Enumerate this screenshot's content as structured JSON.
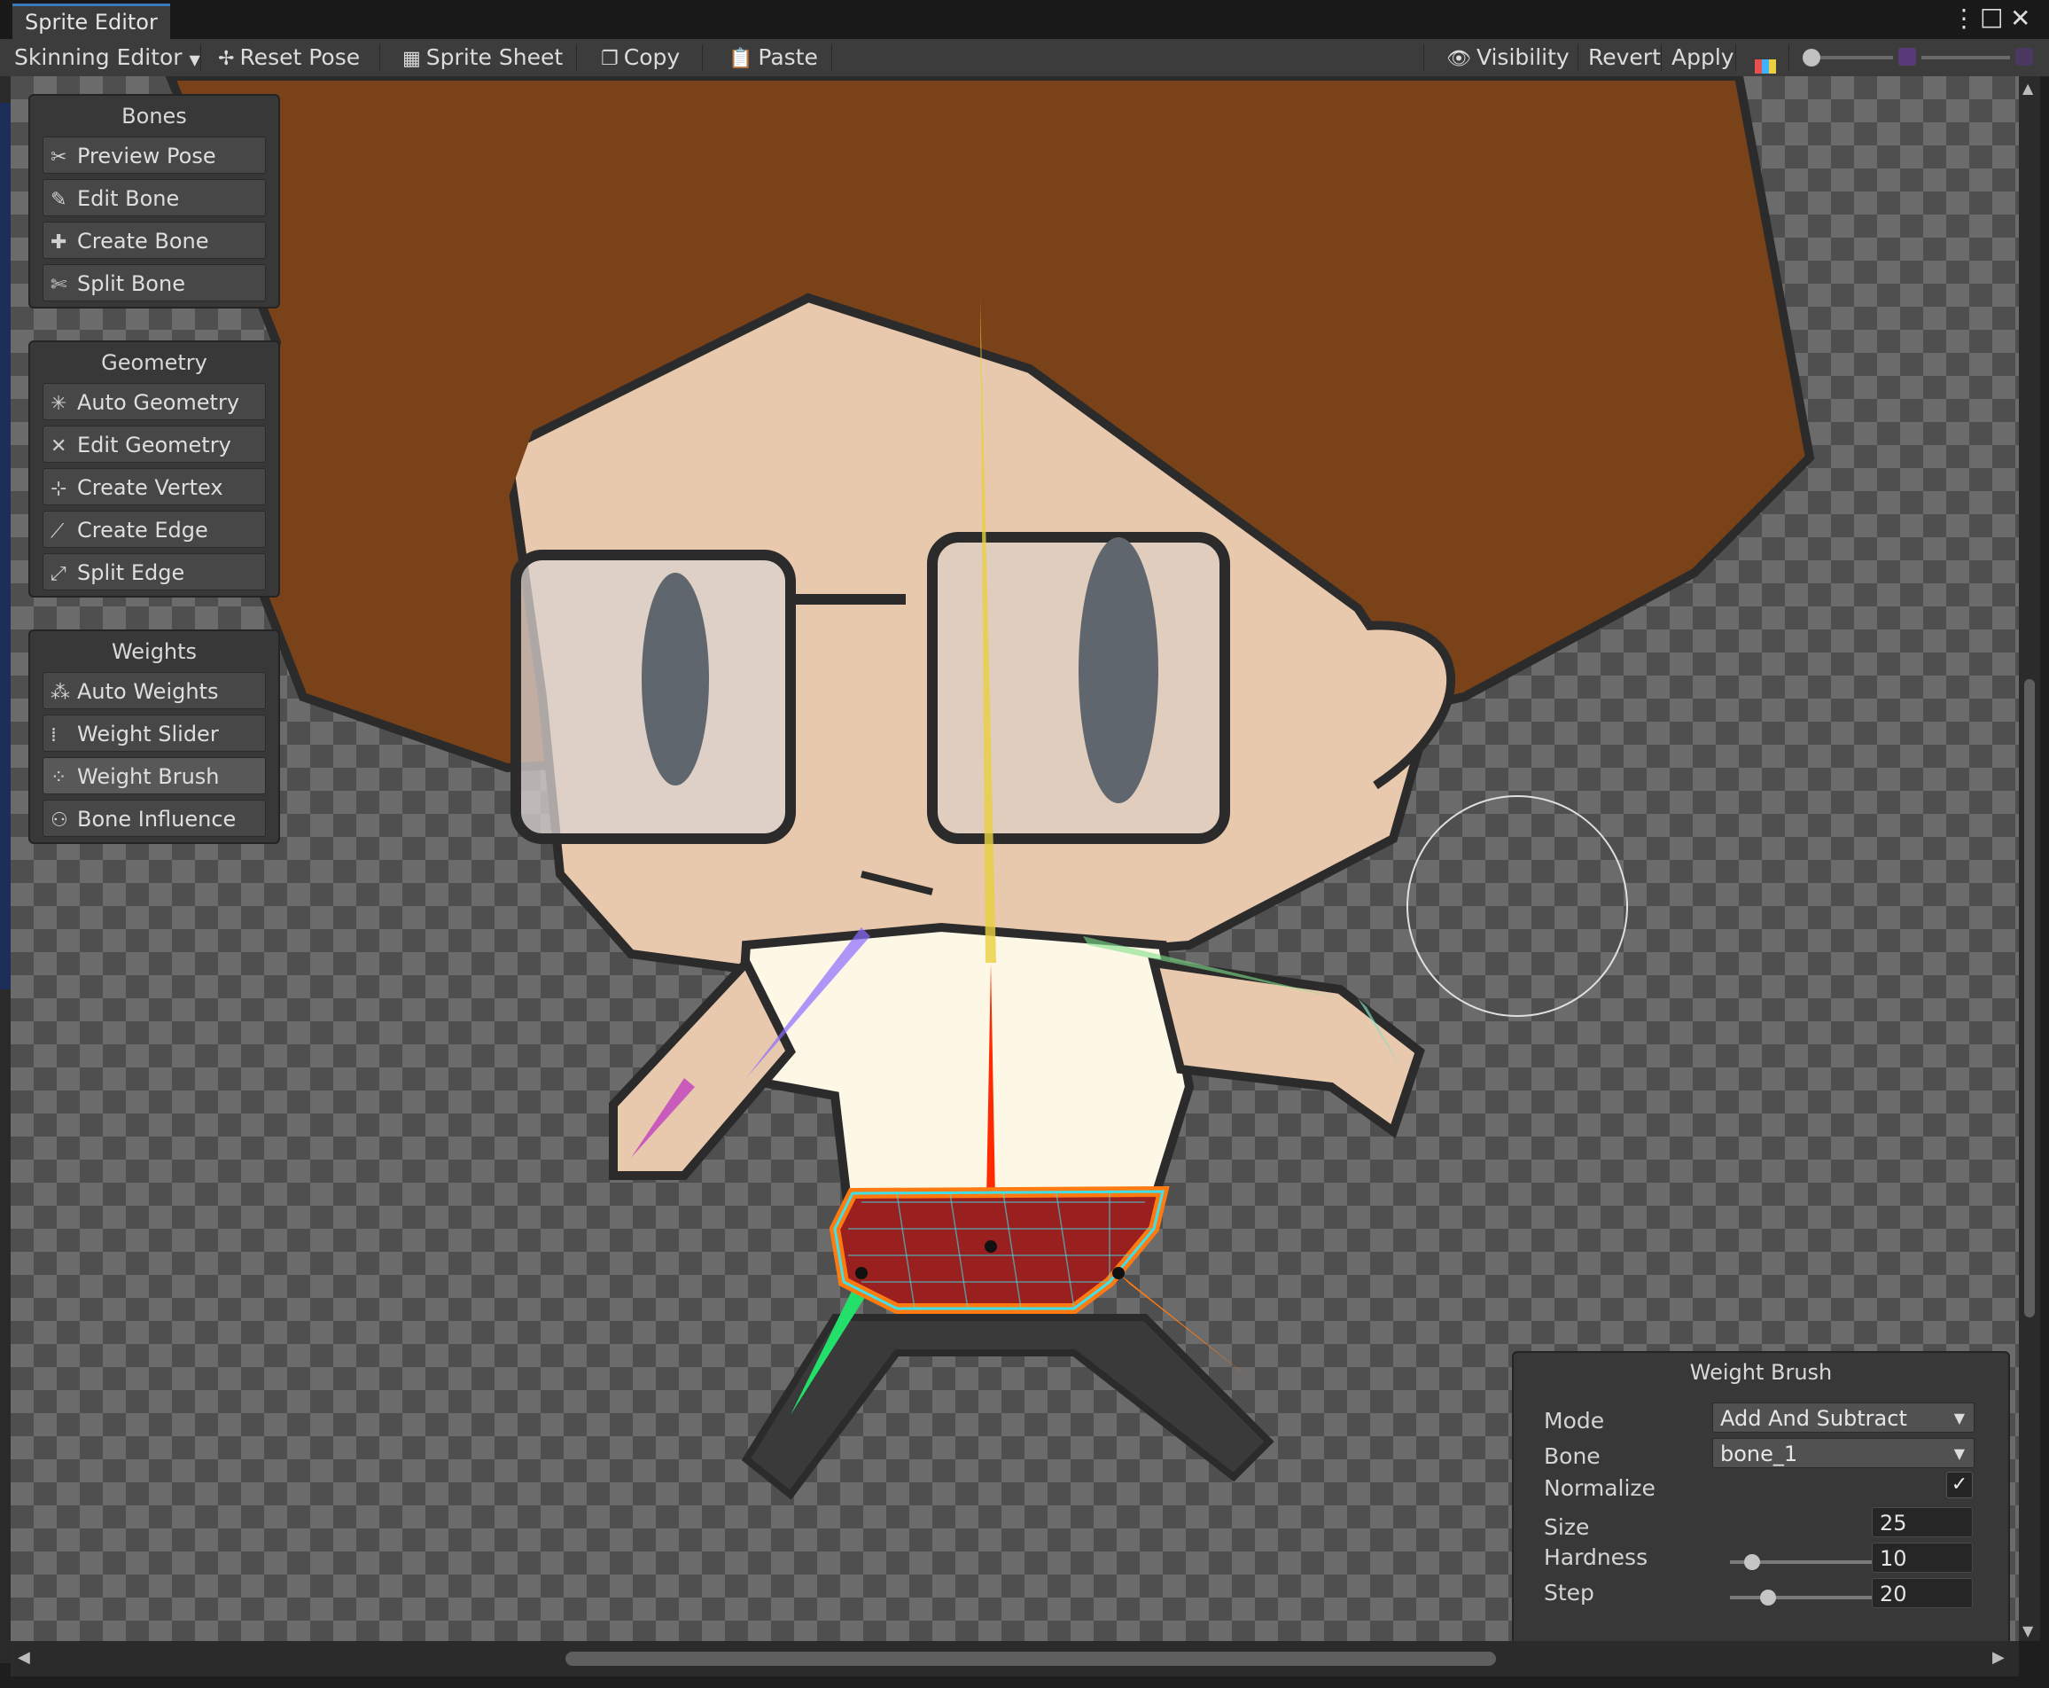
{
  "window": {
    "tab_title": "Sprite Editor",
    "menu_icon": "more-vert-icon",
    "maximize_icon": "maximize-icon",
    "close_icon": "close-icon"
  },
  "toolbar": {
    "mode_label": "Skinning Editor",
    "reset_pose": "Reset Pose",
    "sprite_sheet": "Sprite Sheet",
    "copy": "Copy",
    "paste": "Paste",
    "visibility": "Visibility",
    "revert": "Revert",
    "apply": "Apply"
  },
  "panels": {
    "bones": {
      "title": "Bones",
      "items": [
        {
          "label": "Preview Pose",
          "icon": "preview-pose-icon"
        },
        {
          "label": "Edit Bone",
          "icon": "edit-bone-icon"
        },
        {
          "label": "Create Bone",
          "icon": "create-bone-icon"
        },
        {
          "label": "Split Bone",
          "icon": "split-bone-icon"
        }
      ]
    },
    "geometry": {
      "title": "Geometry",
      "items": [
        {
          "label": "Auto Geometry",
          "icon": "auto-geometry-icon"
        },
        {
          "label": "Edit Geometry",
          "icon": "edit-geometry-icon"
        },
        {
          "label": "Create Vertex",
          "icon": "create-vertex-icon"
        },
        {
          "label": "Create Edge",
          "icon": "create-edge-icon"
        },
        {
          "label": "Split Edge",
          "icon": "split-edge-icon"
        }
      ]
    },
    "weights": {
      "title": "Weights",
      "items": [
        {
          "label": "Auto Weights",
          "icon": "auto-weights-icon"
        },
        {
          "label": "Weight Slider",
          "icon": "weight-slider-icon"
        },
        {
          "label": "Weight Brush",
          "icon": "weight-brush-icon",
          "active": true
        },
        {
          "label": "Bone Influence",
          "icon": "bone-influence-icon"
        }
      ]
    }
  },
  "weight_brush": {
    "title": "Weight Brush",
    "mode_label": "Mode",
    "mode_value": "Add And Subtract",
    "bone_label": "Bone",
    "bone_value": "bone_1",
    "normalize_label": "Normalize",
    "normalize_checked": true,
    "size_label": "Size",
    "size_value": "25",
    "hardness_label": "Hardness",
    "hardness_value": "10",
    "step_label": "Step",
    "step_value": "20"
  },
  "colors": {
    "accent_tab": "#3a79bb",
    "bone_root": "#ff2a00",
    "bone_head": "#e8d040",
    "bone_leg_left": "#22e06a",
    "bone_leg_right": "#ff7a10",
    "bone_arm_left": "#8a6cff",
    "bone_arm_right": "#7fe08a",
    "mesh_outline": "#40e0e8",
    "weight_fill": "#a02020"
  }
}
